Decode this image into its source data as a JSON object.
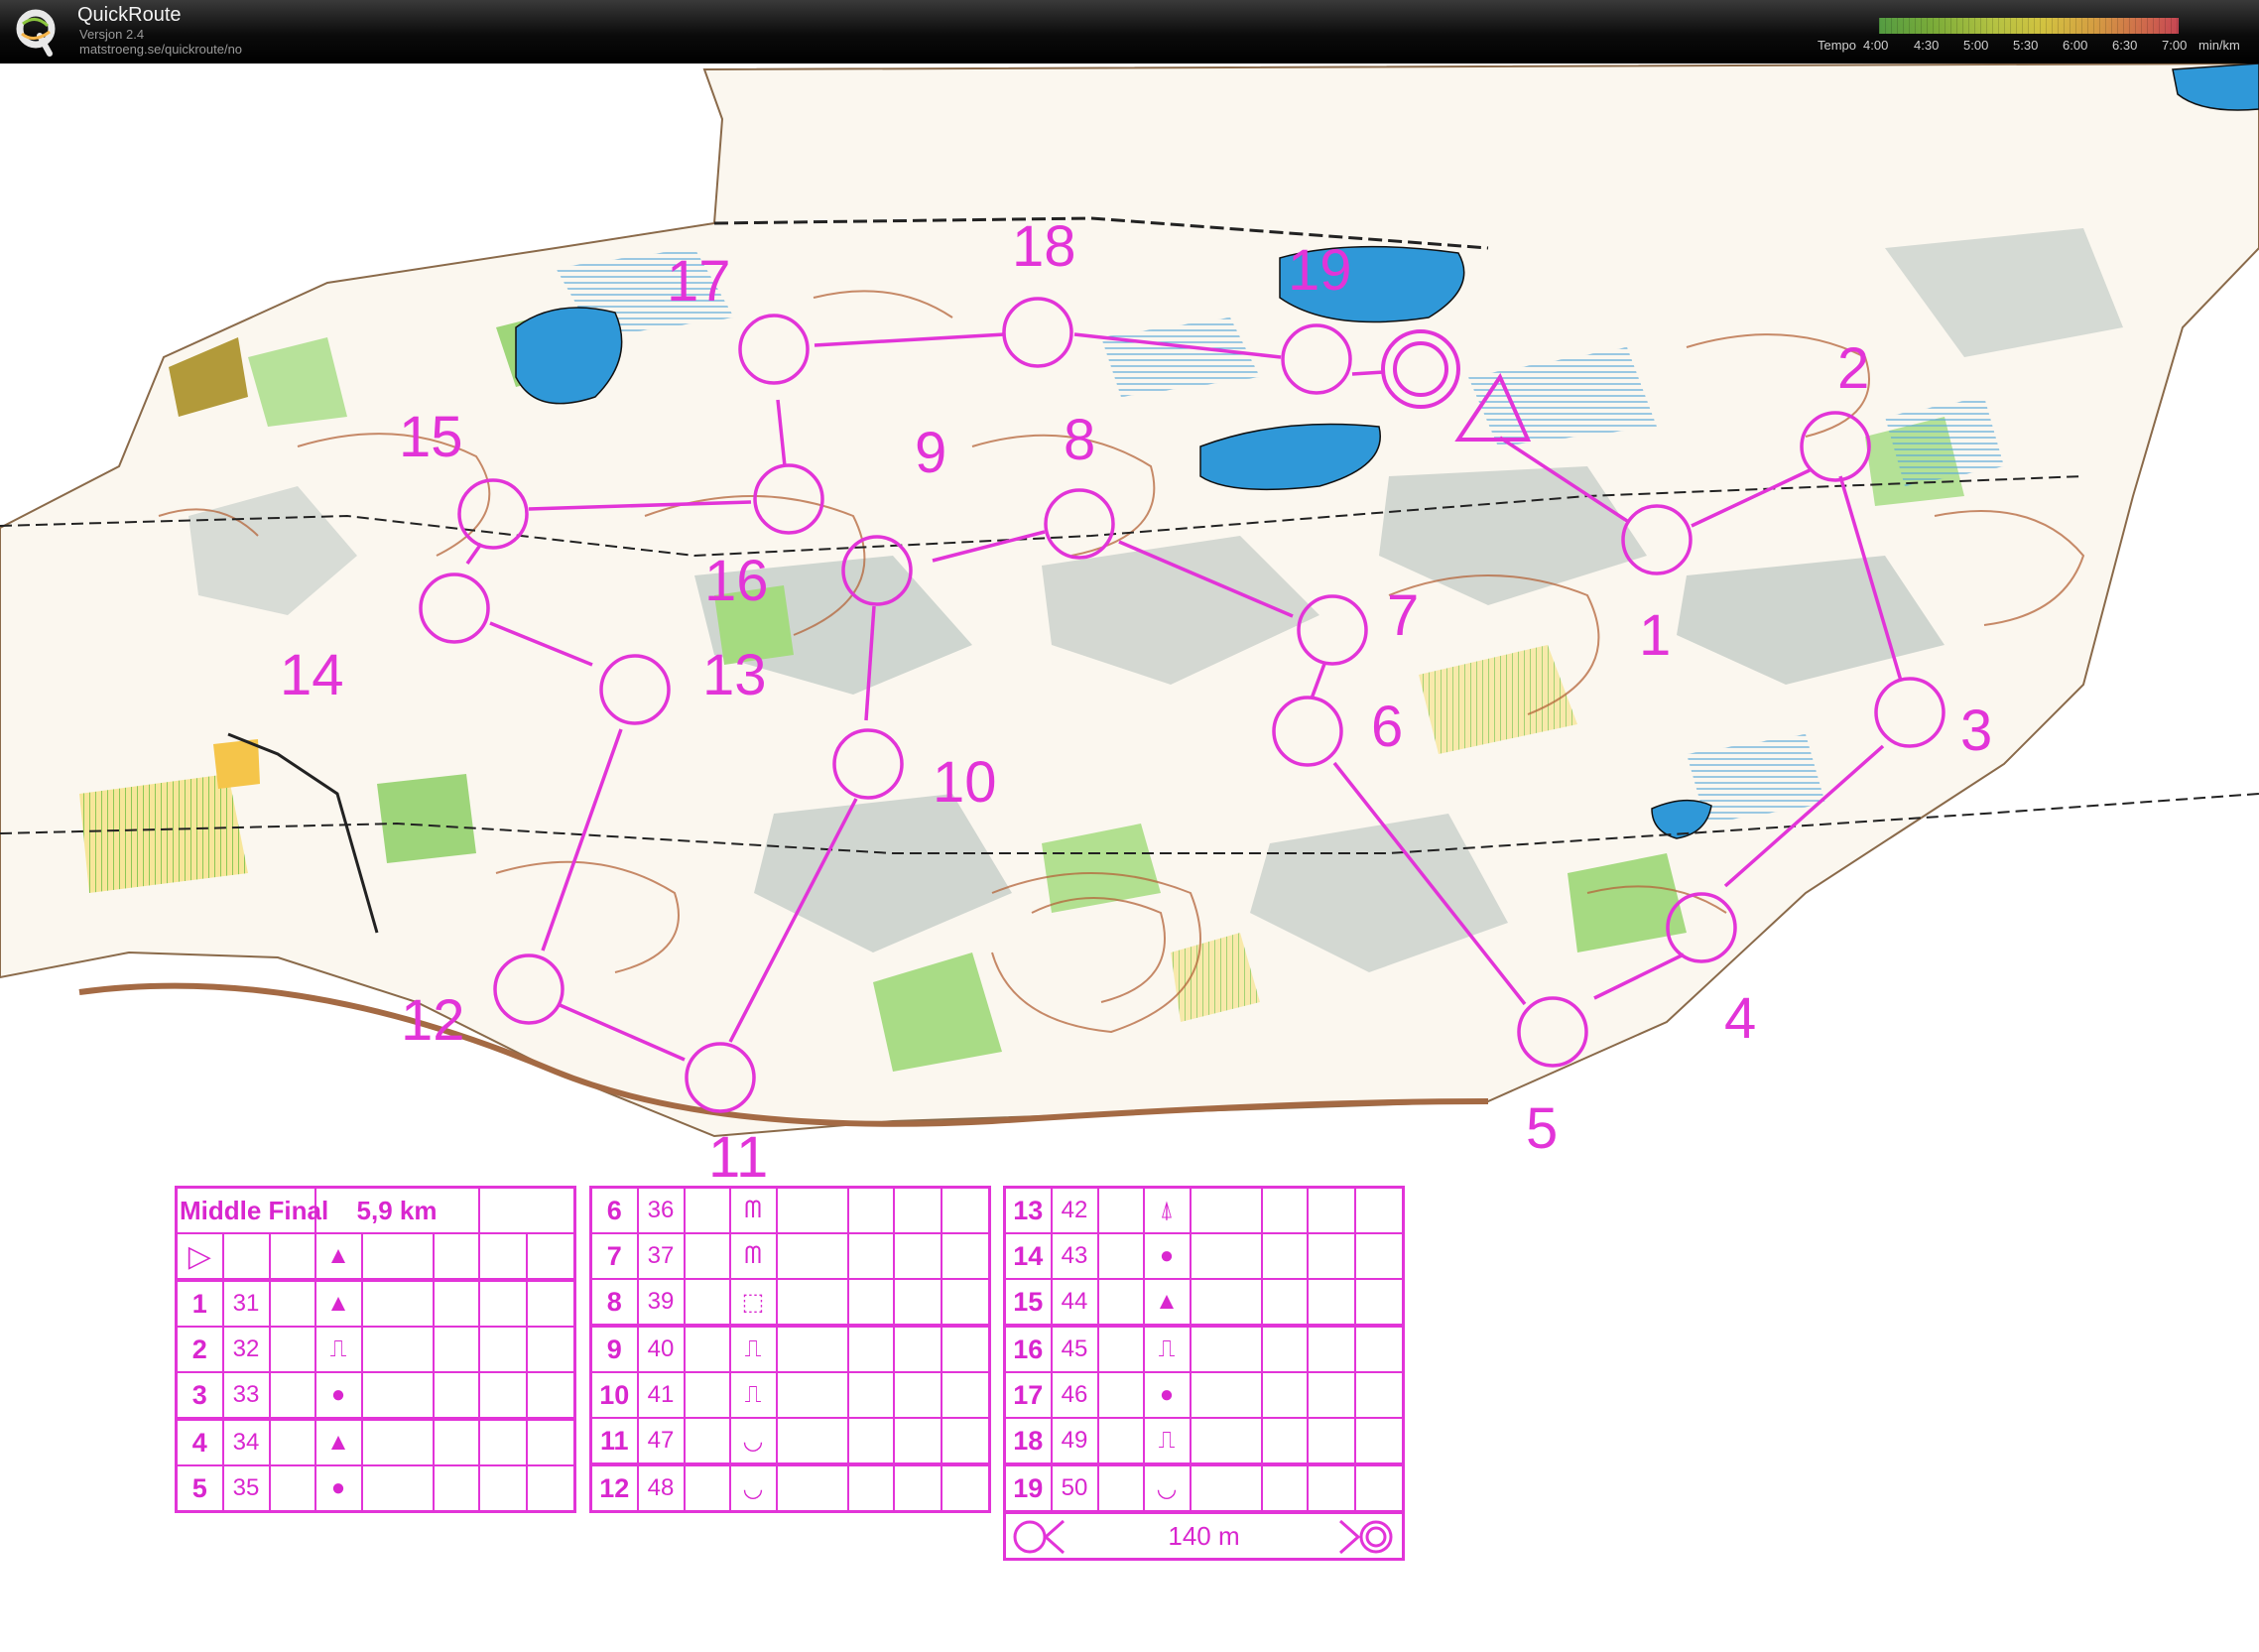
{
  "app": {
    "name": "QuickRoute",
    "version": "Versjon 2.4",
    "url": "matstroeng.se/quickroute/no"
  },
  "tempo_scale": {
    "label": "Tempo",
    "ticks": [
      "4:00",
      "4:30",
      "5:00",
      "5:30",
      "6:00",
      "6:30",
      "7:00"
    ],
    "unit": "min/km",
    "colors": [
      "#5fb34a",
      "#cfe04a",
      "#f3e048",
      "#f6b54a",
      "#ef7a55",
      "#e54e5e"
    ]
  },
  "map": {
    "course_color": "#e234d8",
    "control_numbers": [
      "1",
      "2",
      "3",
      "4",
      "5",
      "6",
      "7",
      "8",
      "9",
      "10",
      "11",
      "12",
      "13",
      "14",
      "15",
      "16",
      "17",
      "18",
      "19"
    ]
  },
  "course": {
    "name": "Middle Final",
    "length": "5,9 km",
    "start_symbol": "start-triangle",
    "finish_distance": "140 m",
    "controls": [
      {
        "seq": "1",
        "code": "31",
        "feature": "▲"
      },
      {
        "seq": "2",
        "code": "32",
        "feature": "⎍"
      },
      {
        "seq": "3",
        "code": "33",
        "feature": "●"
      },
      {
        "seq": "4",
        "code": "34",
        "feature": "▲"
      },
      {
        "seq": "5",
        "code": "35",
        "feature": "●"
      },
      {
        "seq": "6",
        "code": "36",
        "feature": "ᗰ"
      },
      {
        "seq": "7",
        "code": "37",
        "feature": "ᗰ"
      },
      {
        "seq": "8",
        "code": "39",
        "feature": "⬚"
      },
      {
        "seq": "9",
        "code": "40",
        "feature": "⎍"
      },
      {
        "seq": "10",
        "code": "41",
        "feature": "⎍"
      },
      {
        "seq": "11",
        "code": "47",
        "feature": "◡"
      },
      {
        "seq": "12",
        "code": "48",
        "feature": "◡"
      },
      {
        "seq": "13",
        "code": "42",
        "feature": "⍋"
      },
      {
        "seq": "14",
        "code": "43",
        "feature": "●"
      },
      {
        "seq": "15",
        "code": "44",
        "feature": "▲"
      },
      {
        "seq": "16",
        "code": "45",
        "feature": "⎍"
      },
      {
        "seq": "17",
        "code": "46",
        "feature": "●"
      },
      {
        "seq": "18",
        "code": "49",
        "feature": "⎍"
      },
      {
        "seq": "19",
        "code": "50",
        "feature": "◡"
      }
    ]
  }
}
